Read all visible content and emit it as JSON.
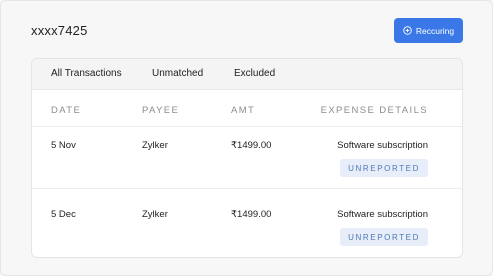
{
  "header": {
    "account_title": "xxxx7425",
    "recurring_button": "Reccuring",
    "recurring_icon": "plus-circle-icon",
    "accent_color": "#3a78e7"
  },
  "tabs": [
    {
      "label": "All Transactions"
    },
    {
      "label": "Unmatched"
    },
    {
      "label": "Excluded"
    }
  ],
  "table": {
    "columns": [
      "DATE",
      "PAYEE",
      "AMT",
      "EXPENSE DETAILS"
    ],
    "rows": [
      {
        "date": "5 Nov",
        "payee": "Zylker",
        "amount": "₹1499.00",
        "expense_details": "Software subscription",
        "status": "UNREPORTED"
      },
      {
        "date": "5 Dec",
        "payee": "Zylker",
        "amount": "₹1499.00",
        "expense_details": "Software subscription",
        "status": "UNREPORTED"
      }
    ]
  }
}
